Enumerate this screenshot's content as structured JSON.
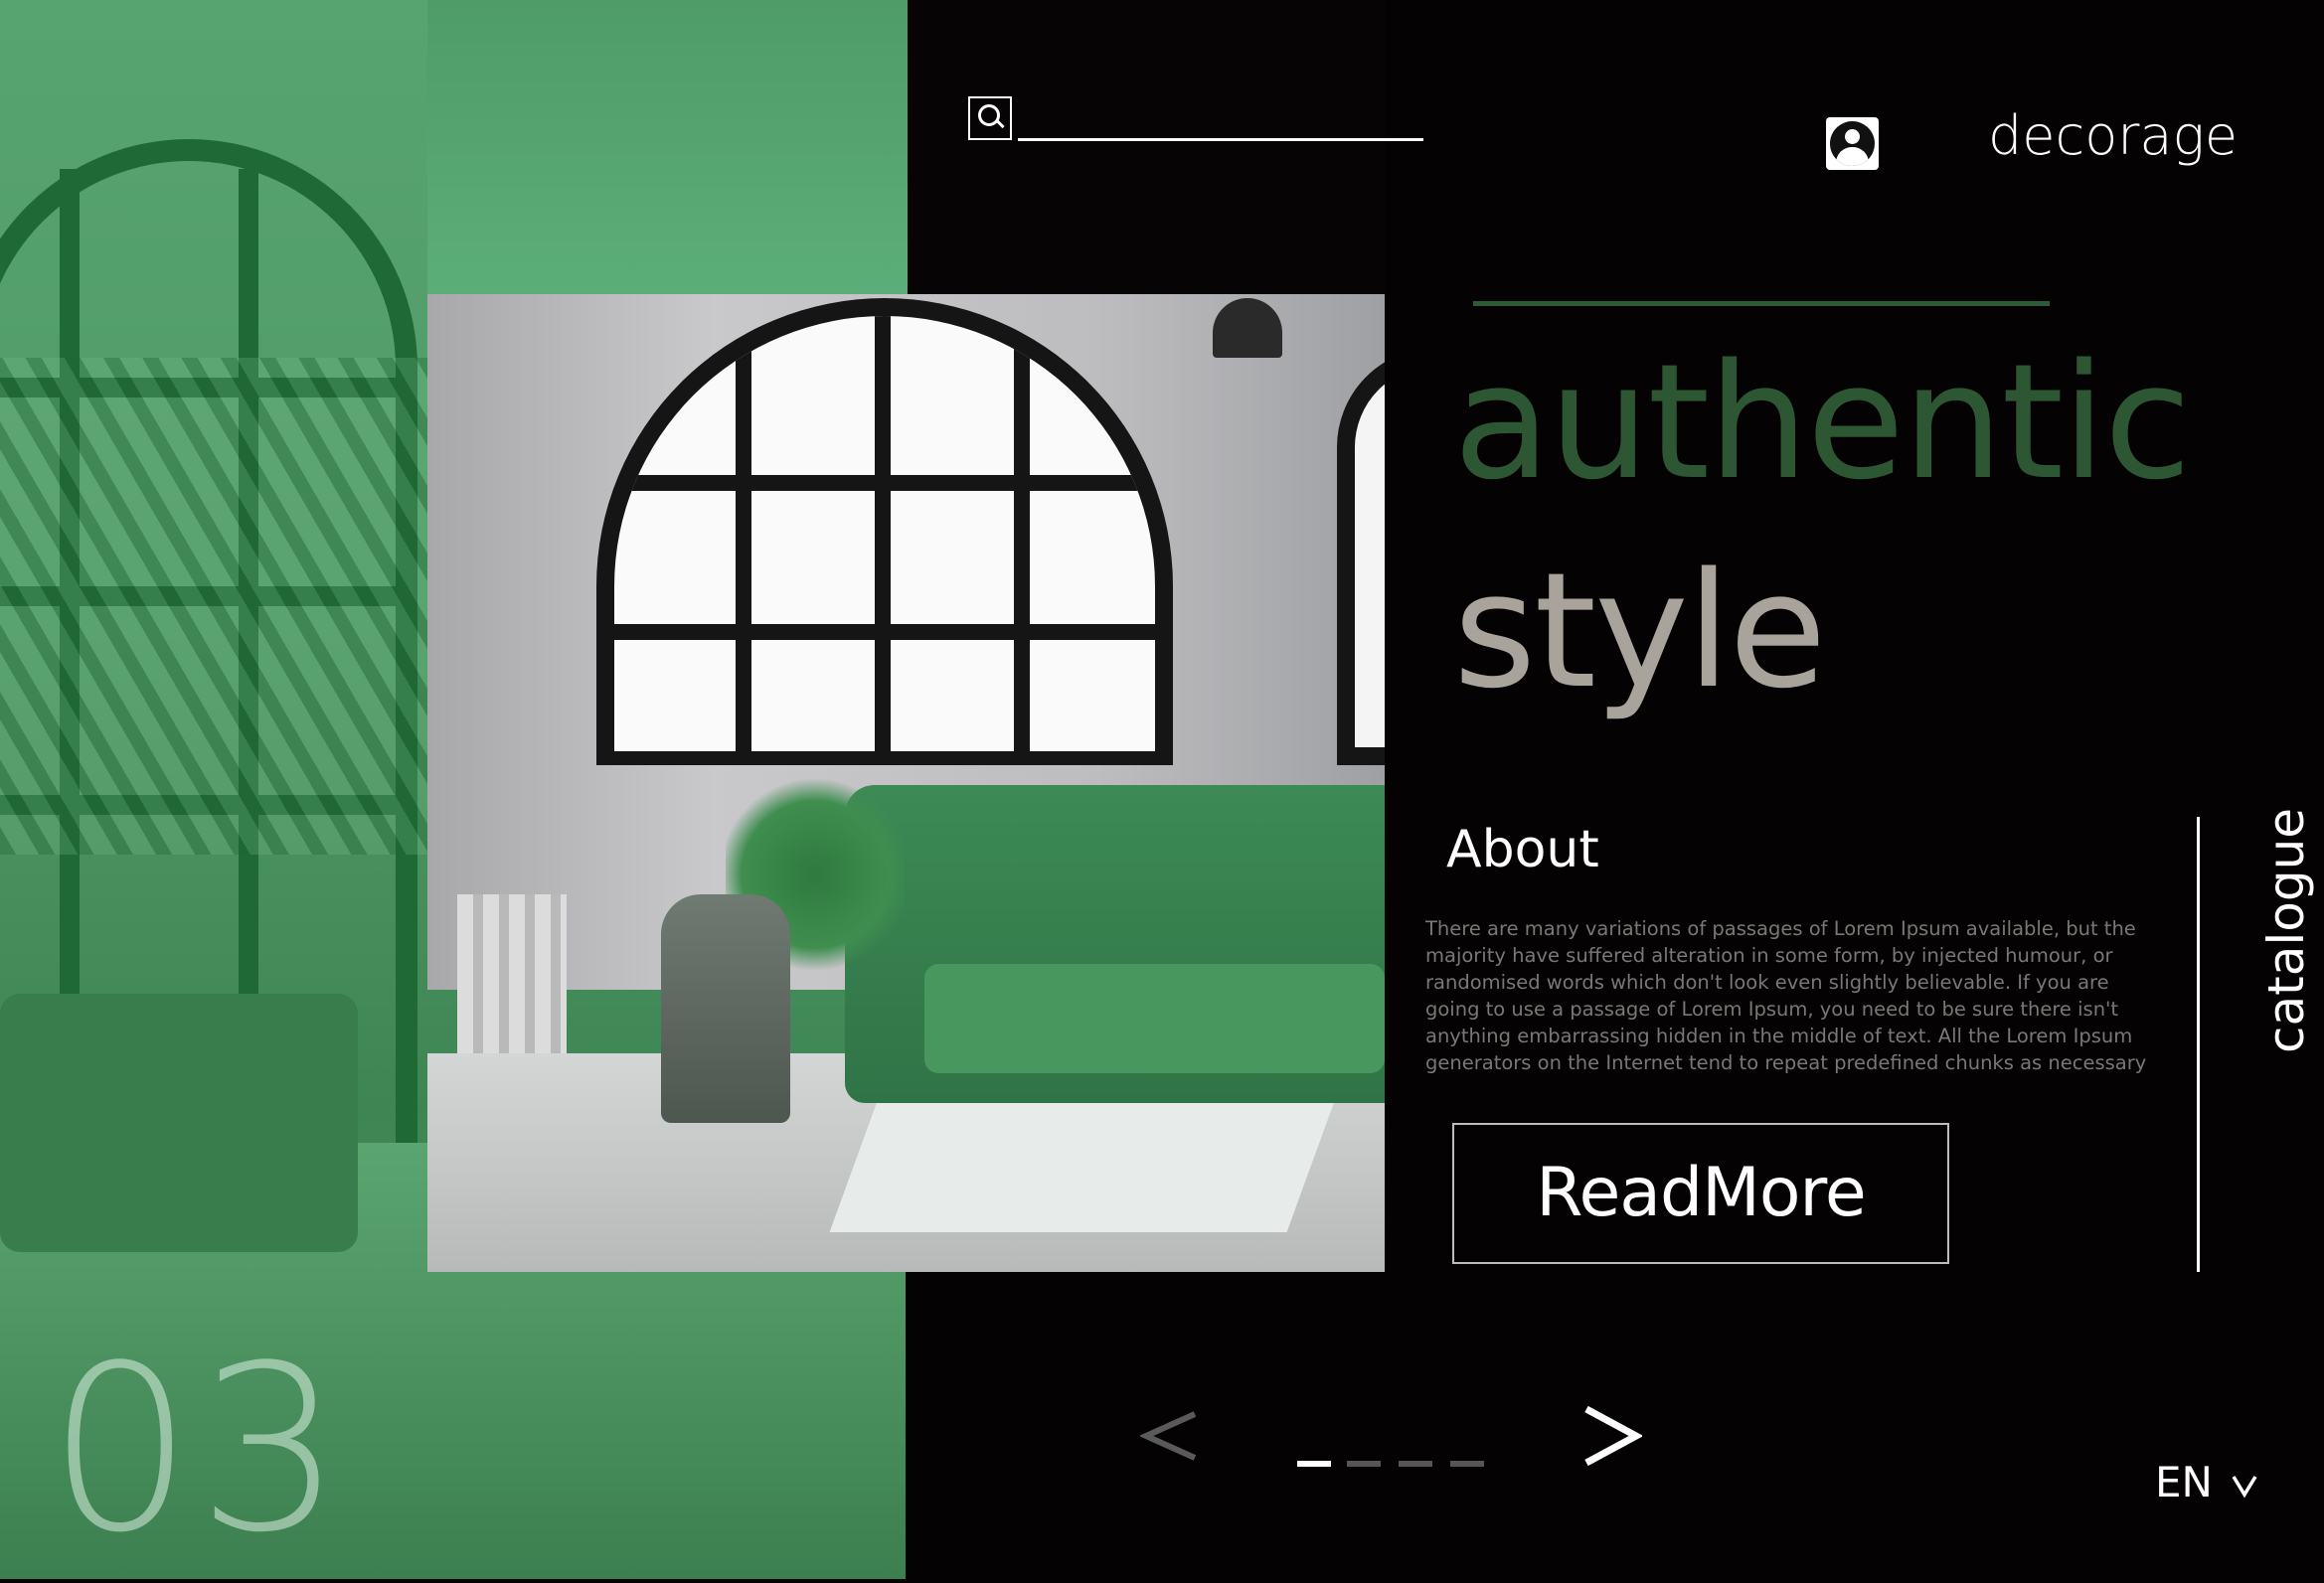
{
  "header": {
    "brand": "decorage",
    "search_placeholder": "",
    "search_value": ""
  },
  "hero": {
    "headline_line1": "authentic",
    "headline_line2": "style",
    "slide_number": "03"
  },
  "about": {
    "title": "About",
    "body": "There are many variations of passages of Lorem Ipsum available, but the majority have suffered alteration in some form, by injected humour, or randomised words which don't look even slightly believable. If you are going to use a passage of Lorem Ipsum, you need to be sure there isn't anything embarrassing hidden in the middle of text. All the Lorem Ipsum generators on the Internet tend to repeat predefined chunks as necessary",
    "button_label": "ReadMore"
  },
  "side": {
    "catalogue_label": "catalogue"
  },
  "pagination": {
    "prev_icon": "chevron-left-icon",
    "next_icon": "chevron-right-icon",
    "dot_count": 4,
    "active_index": 0
  },
  "language": {
    "selected": "EN"
  },
  "colors": {
    "background": "#050203",
    "accent_green": "#2d5633",
    "headline_grey": "#a8a49c",
    "panel_green": "#4f9a66"
  }
}
